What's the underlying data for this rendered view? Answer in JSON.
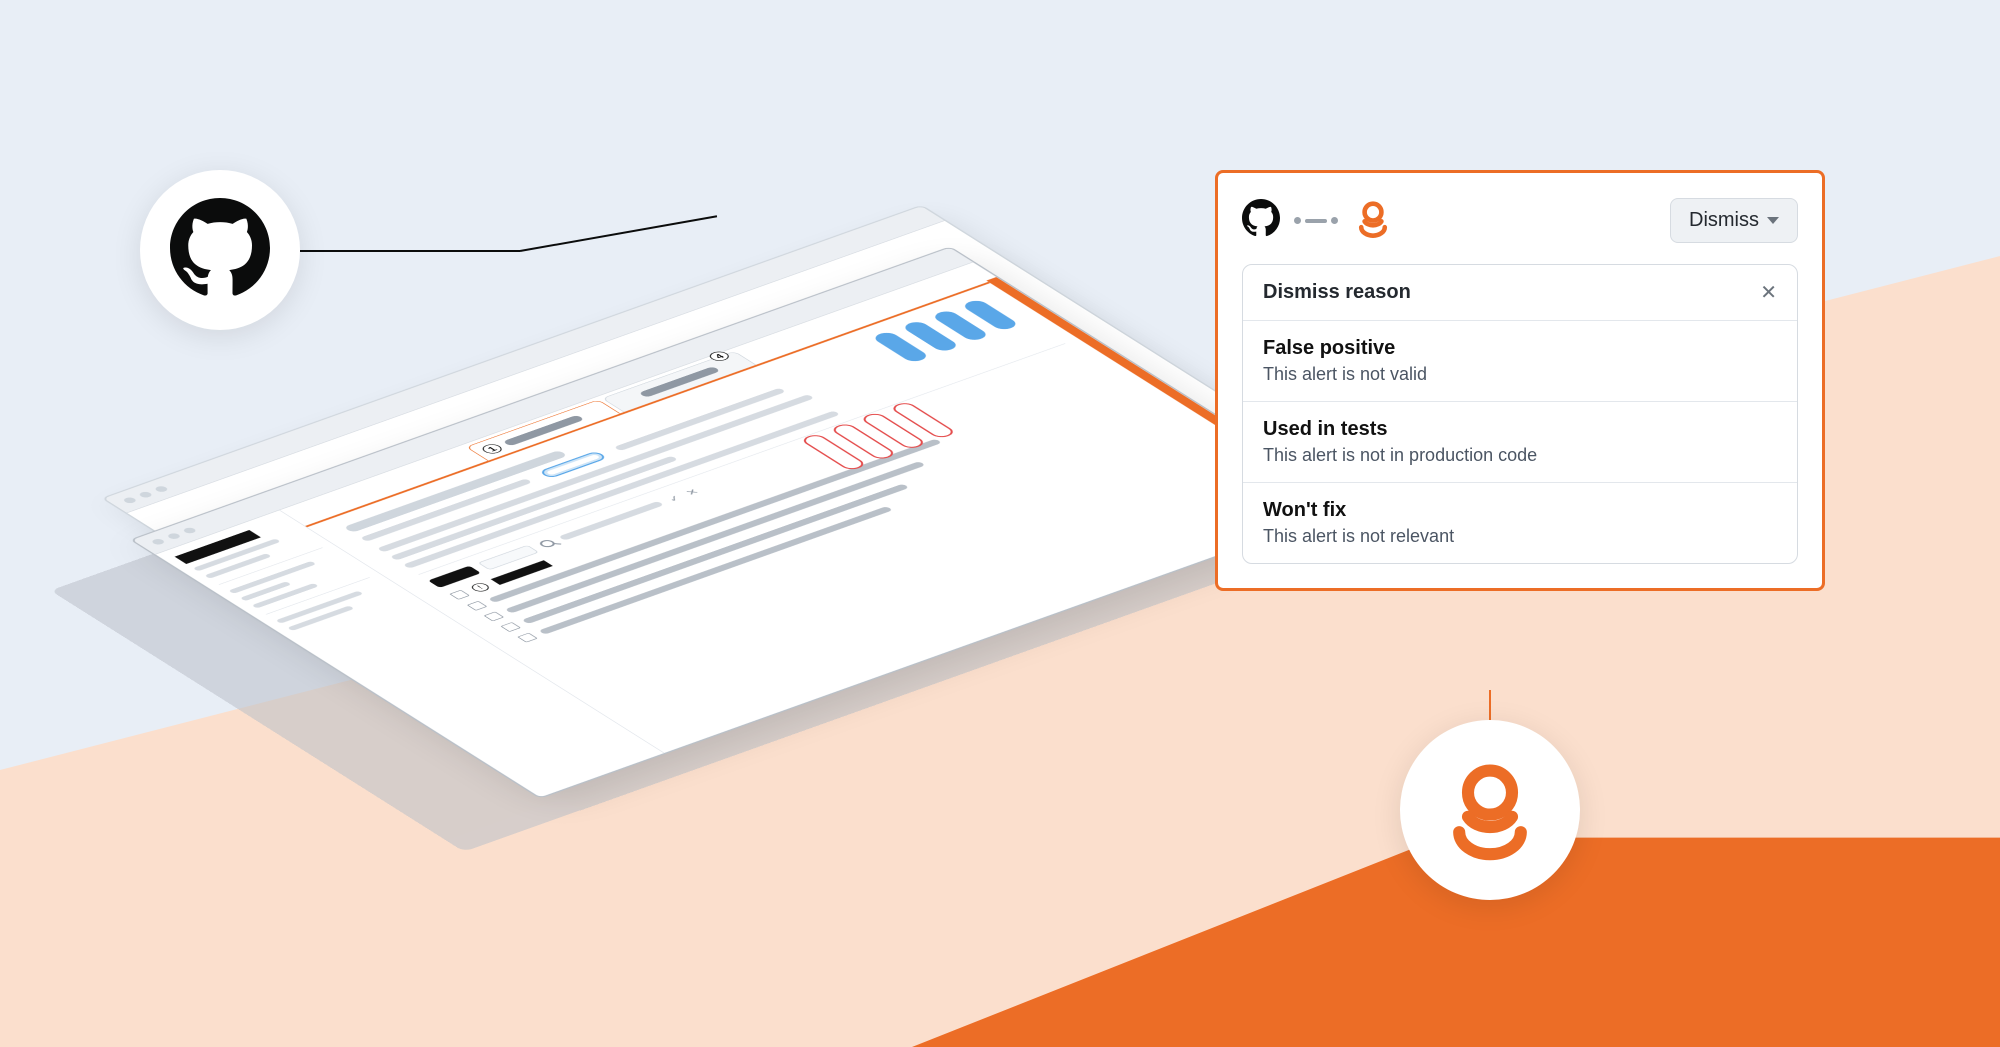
{
  "colors": {
    "accent": "#ec6d26",
    "peach": "#fbdfcd",
    "sky": "#e8eef6",
    "blue_pill": "#5aa7e8",
    "red_pill_border": "#e44c4c"
  },
  "illustration": {
    "tab_badges": [
      "1",
      "4"
    ]
  },
  "card": {
    "dismiss_button_label": "Dismiss",
    "menu_title": "Dismiss reason",
    "options": [
      {
        "title": "False positive",
        "desc": "This alert is not valid"
      },
      {
        "title": "Used in tests",
        "desc": "This alert is not in production code"
      },
      {
        "title": "Won't fix",
        "desc": "This alert is not relevant"
      }
    ]
  }
}
